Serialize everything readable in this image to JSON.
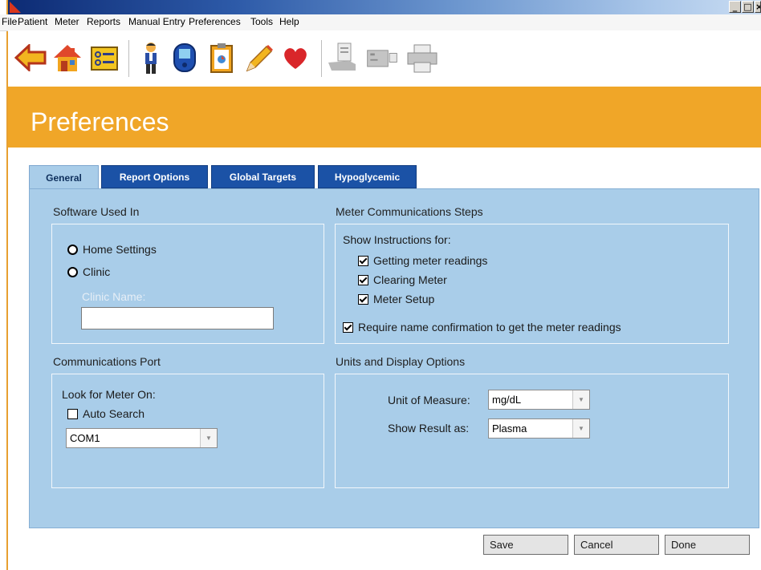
{
  "window": {
    "controls": [
      "_",
      "□",
      "×"
    ]
  },
  "menu": [
    "File",
    "Patient",
    "Meter",
    "Reports",
    "Manual Entry",
    "Preferences",
    "Tools",
    "Help"
  ],
  "toolbar": [
    {
      "icon": "back-arrow-icon"
    },
    {
      "icon": "home-icon"
    },
    {
      "icon": "patient-list-icon"
    },
    {
      "icon": "person-icon"
    },
    {
      "icon": "meter-device-icon"
    },
    {
      "icon": "clipboard-icon"
    },
    {
      "icon": "pencil-icon"
    },
    {
      "icon": "heart-icon"
    },
    {
      "icon": "hand-document-icon"
    },
    {
      "icon": "cable-connector-icon"
    },
    {
      "icon": "printer-icon"
    }
  ],
  "page": {
    "title": "Preferences"
  },
  "tabs": [
    {
      "label": "General",
      "active": true
    },
    {
      "label": "Report Options",
      "active": false
    },
    {
      "label": "Global Targets",
      "active": false
    },
    {
      "label": "Hypoglycemic",
      "active": false
    }
  ],
  "software": {
    "title": "Software Used In",
    "home_label": "Home Settings",
    "clinic_label": "Clinic",
    "clinic_name_placeholder": "Clinic Name:",
    "clinic_name_value": ""
  },
  "meter_comm": {
    "title": "Meter Communications Steps",
    "show_for": "Show Instructions for:",
    "items": [
      {
        "label": "Getting meter readings",
        "checked": true
      },
      {
        "label": "Clearing Meter",
        "checked": true
      },
      {
        "label": "Meter Setup",
        "checked": true
      }
    ],
    "require_confirm": {
      "label": "Require name confirmation to get the meter readings",
      "checked": true
    }
  },
  "comm_port": {
    "title": "Communications Port",
    "look_for": "Look for Meter On:",
    "auto_search": {
      "label": "Auto Search",
      "checked": false
    },
    "port": "COM1"
  },
  "units": {
    "title": "Units and Display Options",
    "unit_label": "Unit of Measure:",
    "unit_value": "mg/dL",
    "result_label": "Show Result as:",
    "result_value": "Plasma"
  },
  "buttons": {
    "save": "Save",
    "cancel": "Cancel",
    "done": "Done"
  },
  "colors": {
    "header": "#f0a628",
    "panel": "#a9cde9",
    "tab_inactive": "#1b52a6"
  }
}
